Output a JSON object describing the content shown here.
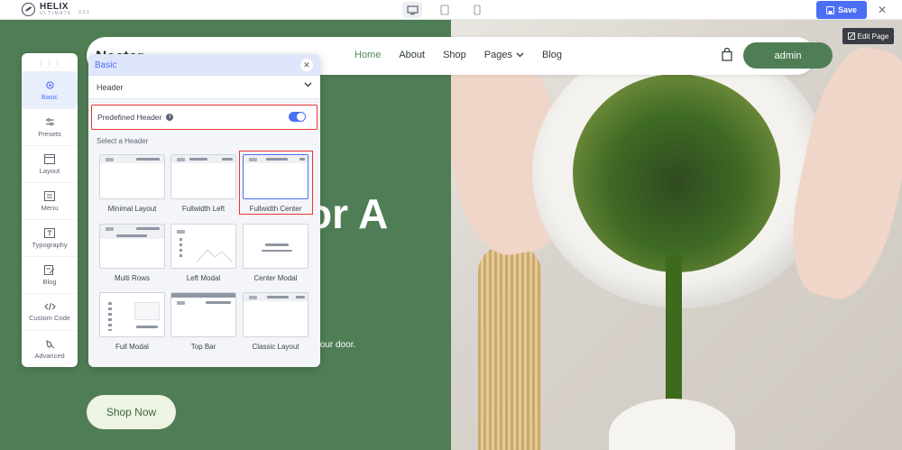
{
  "topbar": {
    "logo_name": "HELIX",
    "logo_sub": "ULTIMATE",
    "version": "2.1.1",
    "save_label": "Save",
    "close_glyph": "✕",
    "device_icons": [
      "desktop-icon",
      "tablet-icon",
      "mobile-icon"
    ],
    "accent": "#4b6ef5"
  },
  "site": {
    "brand": "Nectar",
    "nav": [
      "Home",
      "About",
      "Shop",
      "Pages",
      "Blog"
    ],
    "admin_label": "admin",
    "hero_title_fragment": "or A",
    "hero_sub_fragment": "er to your door.",
    "shop_now_label": "Shop Now",
    "edit_page_label": "Edit Page",
    "green": "#4f7d55"
  },
  "sidebar": {
    "items": [
      {
        "label": "Basic",
        "icon": "gear-icon"
      },
      {
        "label": "Presets",
        "icon": "sliders-icon"
      },
      {
        "label": "Layout",
        "icon": "layout-icon"
      },
      {
        "label": "Menu",
        "icon": "menu-icon"
      },
      {
        "label": "Typography",
        "icon": "typography-icon"
      },
      {
        "label": "Blog",
        "icon": "blog-icon"
      },
      {
        "label": "Custom Code",
        "icon": "code-icon"
      },
      {
        "label": "Advanced",
        "icon": "advanced-icon"
      }
    ]
  },
  "panel": {
    "title": "Basic",
    "close_glyph": "✕",
    "section_value": "Header",
    "predefined_label": "Predefined Header",
    "predefined_enabled": true,
    "select_label": "Select a Header",
    "headers": [
      "Minimal Layout",
      "Fullwidth Left",
      "Fullwidth Center",
      "Multi Rows",
      "Left Modal",
      "Center Modal",
      "Full Modal",
      "Top Bar",
      "Classic Layout"
    ],
    "selected_header": "Fullwidth Center"
  }
}
